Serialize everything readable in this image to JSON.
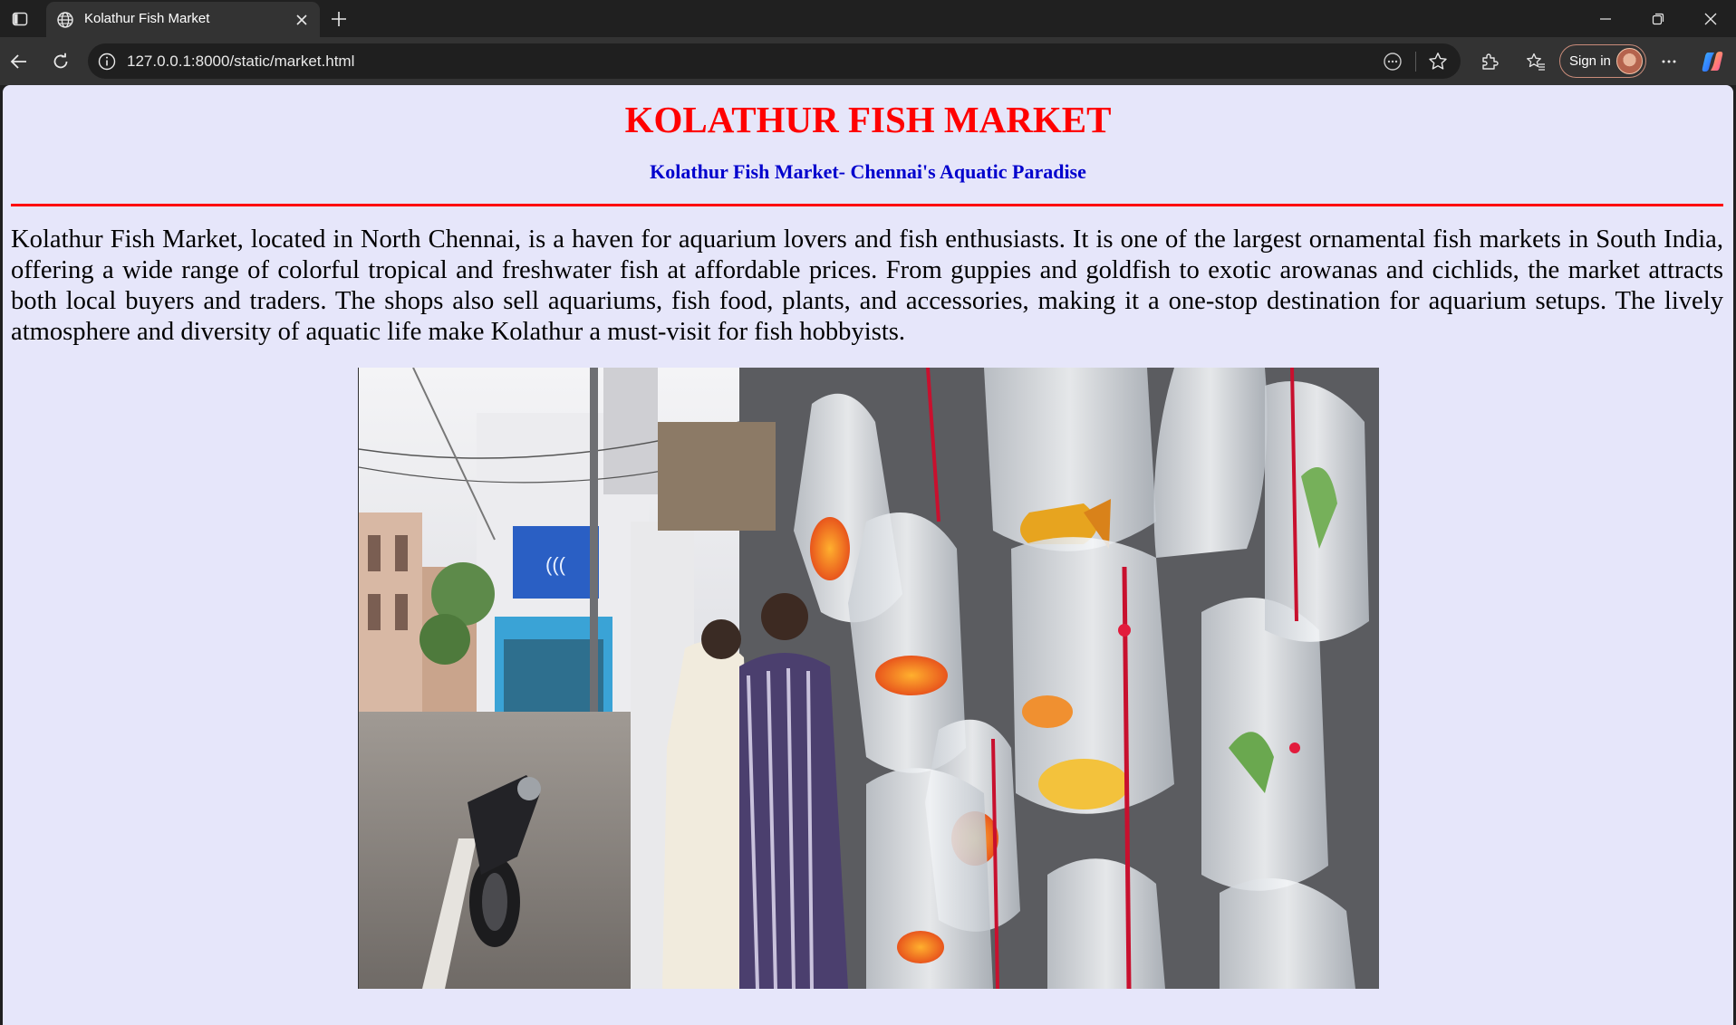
{
  "browser": {
    "tab_title": "Kolathur Fish Market",
    "url": "127.0.0.1:8000/static/market.html",
    "sign_in_label": "Sign in",
    "icons": [
      "sidebar-icon",
      "globe-icon",
      "close-icon",
      "plus-icon",
      "minimize-icon",
      "restore-icon",
      "close-window-icon",
      "back-icon",
      "reload-icon",
      "info-icon",
      "reading-mode-icon",
      "star-icon",
      "extensions-icon",
      "favorites-icon",
      "more-icon",
      "copilot-icon"
    ]
  },
  "page": {
    "background": "#e6e6fa",
    "title": "KOLATHUR FISH MARKET",
    "title_color": "#ff0000",
    "subtitle": "Kolathur Fish Market- Chennai's Aquatic Paradise",
    "subtitle_color": "#0000cd",
    "intro": "Kolathur Fish Market, located in North Chennai, is a haven for aquarium lovers and fish enthusiasts. It is one of the largest ornamental fish markets in South India, offering a wide range of colorful tropical and freshwater fish at affordable prices. From guppies and goldfish to exotic arowanas and cichlids, the market attracts both local buyers and traders. The shops also sell aquariums, fish food, plants, and accessories, making it a one-stop destination for aquarium setups. The lively atmosphere and diversity of aquatic life make Kolathur a must-visit for fish hobbyists."
  }
}
